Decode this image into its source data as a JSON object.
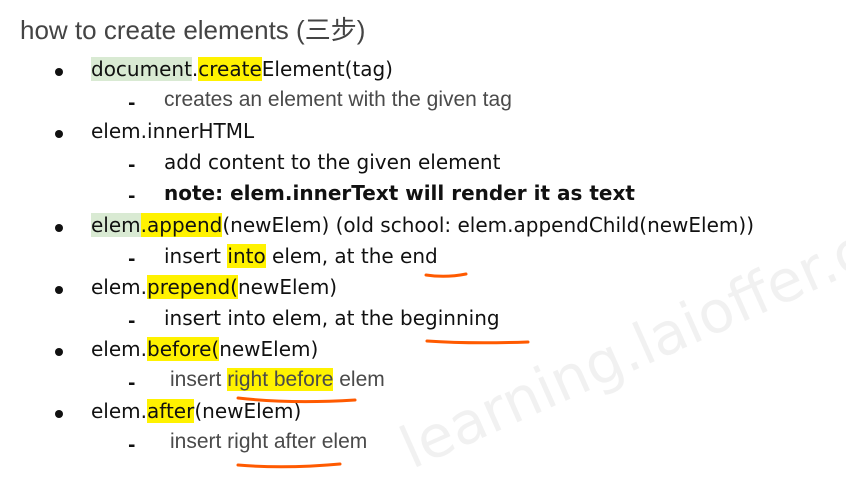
{
  "title": "how to create elements (三步)",
  "watermark": "learning.laioffer.com",
  "colors": {
    "green_highlight": "#d9ead3",
    "yellow_highlight": "#fff200",
    "underline": "#ff5a00"
  },
  "lines": [
    {
      "level": 1,
      "segments": [
        {
          "t": "document",
          "hl": "green"
        },
        {
          "t": "."
        },
        {
          "t": "create",
          "hl": "yellow"
        },
        {
          "t": "Element(tag)"
        }
      ]
    },
    {
      "level": 2,
      "segments": [
        {
          "t": "creates an element with the given tag"
        }
      ]
    },
    {
      "level": 1,
      "segments": [
        {
          "t": "elem.innerHTML"
        }
      ]
    },
    {
      "level": 2,
      "segments": [
        {
          "t": "add content to the given element"
        }
      ]
    },
    {
      "level": 2,
      "segments": [
        {
          "t": "note: elem.innerText will render it as text"
        }
      ]
    },
    {
      "level": 1,
      "segments": [
        {
          "t": "elem",
          "hl": "green"
        },
        {
          "t": ".append",
          "hl": "yellow"
        },
        {
          "t": "(newElem) (old school: elem.appendChild(newElem))"
        }
      ]
    },
    {
      "level": 2,
      "segments": [
        {
          "t": "insert "
        },
        {
          "t": "into",
          "hl": "yellow"
        },
        {
          "t": " elem, at the end"
        }
      ]
    },
    {
      "level": 1,
      "segments": [
        {
          "t": "elem."
        },
        {
          "t": "prepend(",
          "hl": "yellow"
        },
        {
          "t": "newElem)"
        }
      ]
    },
    {
      "level": 2,
      "segments": [
        {
          "t": "insert into elem, at the beginning"
        }
      ]
    },
    {
      "level": 1,
      "segments": [
        {
          "t": "elem."
        },
        {
          "t": "before(",
          "hl": "yellow"
        },
        {
          "t": "newElem)"
        }
      ]
    },
    {
      "level": 2,
      "segments": [
        {
          "t": "insert "
        },
        {
          "t": "right before",
          "hl": "yellow"
        },
        {
          "t": " elem"
        }
      ]
    },
    {
      "level": 1,
      "segments": [
        {
          "t": "elem."
        },
        {
          "t": "after",
          "hl": "yellow"
        },
        {
          "t": "(newElem)"
        }
      ]
    },
    {
      "level": 2,
      "segments": [
        {
          "t": "insert right after elem"
        }
      ]
    }
  ]
}
